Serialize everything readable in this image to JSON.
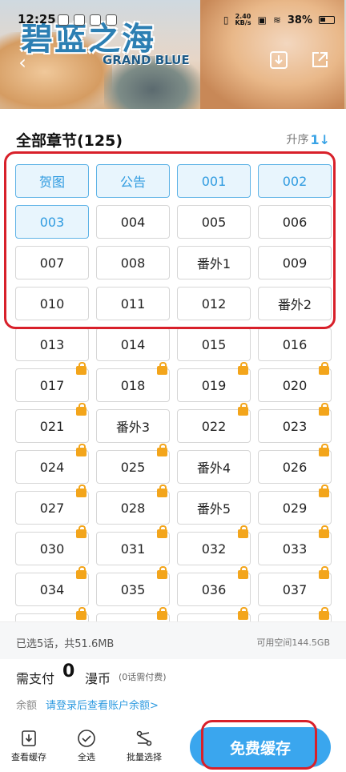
{
  "status_bar": {
    "time": "12:25",
    "speed_top": "2.40",
    "speed_bottom": "KB/s",
    "battery": "38%"
  },
  "banner": {
    "logo": "碧蓝之海",
    "logo_sub": "GRAND BLUE"
  },
  "chapters": {
    "title": "全部章节(125)",
    "sort_label": "升序",
    "sort_icon": "1↓",
    "items": [
      {
        "label": "贺图",
        "selected": true,
        "locked": false
      },
      {
        "label": "公告",
        "selected": true,
        "locked": false
      },
      {
        "label": "001",
        "selected": true,
        "locked": false
      },
      {
        "label": "002",
        "selected": true,
        "locked": false
      },
      {
        "label": "003",
        "selected": true,
        "locked": false
      },
      {
        "label": "004",
        "selected": false,
        "locked": false
      },
      {
        "label": "005",
        "selected": false,
        "locked": false
      },
      {
        "label": "006",
        "selected": false,
        "locked": false
      },
      {
        "label": "007",
        "selected": false,
        "locked": false
      },
      {
        "label": "008",
        "selected": false,
        "locked": false
      },
      {
        "label": "番外1",
        "selected": false,
        "locked": false
      },
      {
        "label": "009",
        "selected": false,
        "locked": false
      },
      {
        "label": "010",
        "selected": false,
        "locked": false
      },
      {
        "label": "011",
        "selected": false,
        "locked": false
      },
      {
        "label": "012",
        "selected": false,
        "locked": false
      },
      {
        "label": "番外2",
        "selected": false,
        "locked": false
      },
      {
        "label": "013",
        "selected": false,
        "locked": false
      },
      {
        "label": "014",
        "selected": false,
        "locked": false
      },
      {
        "label": "015",
        "selected": false,
        "locked": false
      },
      {
        "label": "016",
        "selected": false,
        "locked": false
      },
      {
        "label": "017",
        "selected": false,
        "locked": true
      },
      {
        "label": "018",
        "selected": false,
        "locked": true
      },
      {
        "label": "019",
        "selected": false,
        "locked": true
      },
      {
        "label": "020",
        "selected": false,
        "locked": true
      },
      {
        "label": "021",
        "selected": false,
        "locked": true
      },
      {
        "label": "番外3",
        "selected": false,
        "locked": false
      },
      {
        "label": "022",
        "selected": false,
        "locked": true
      },
      {
        "label": "023",
        "selected": false,
        "locked": true
      },
      {
        "label": "024",
        "selected": false,
        "locked": true
      },
      {
        "label": "025",
        "selected": false,
        "locked": true
      },
      {
        "label": "番外4",
        "selected": false,
        "locked": false
      },
      {
        "label": "026",
        "selected": false,
        "locked": true
      },
      {
        "label": "027",
        "selected": false,
        "locked": true
      },
      {
        "label": "028",
        "selected": false,
        "locked": true
      },
      {
        "label": "番外5",
        "selected": false,
        "locked": false
      },
      {
        "label": "029",
        "selected": false,
        "locked": true
      },
      {
        "label": "030",
        "selected": false,
        "locked": true
      },
      {
        "label": "031",
        "selected": false,
        "locked": true
      },
      {
        "label": "032",
        "selected": false,
        "locked": true
      },
      {
        "label": "033",
        "selected": false,
        "locked": true
      },
      {
        "label": "034",
        "selected": false,
        "locked": true
      },
      {
        "label": "035",
        "selected": false,
        "locked": true
      },
      {
        "label": "036",
        "selected": false,
        "locked": true
      },
      {
        "label": "037",
        "selected": false,
        "locked": true
      },
      {
        "label": "",
        "selected": false,
        "locked": true
      },
      {
        "label": "",
        "selected": false,
        "locked": true
      },
      {
        "label": "",
        "selected": false,
        "locked": true
      },
      {
        "label": "",
        "selected": false,
        "locked": true
      }
    ]
  },
  "summary": {
    "selected_info": "已选5话，共51.6MB",
    "free_space": "可用空间144.5GB",
    "pay_label": "需支付",
    "pay_amount": "0",
    "pay_unit": "漫币",
    "pay_note": "(0话需付费)",
    "balance_label": "余额",
    "balance_link": "请登录后查看账户余额>"
  },
  "toolbar": {
    "view_cache": "查看缓存",
    "select_all": "全选",
    "batch_select": "批量选择",
    "free_cache": "免费缓存"
  },
  "colors": {
    "accent": "#3aa6ee",
    "selected_bg": "#e8f5fd",
    "lock": "#f3a51b",
    "highlight": "#d8202a"
  }
}
